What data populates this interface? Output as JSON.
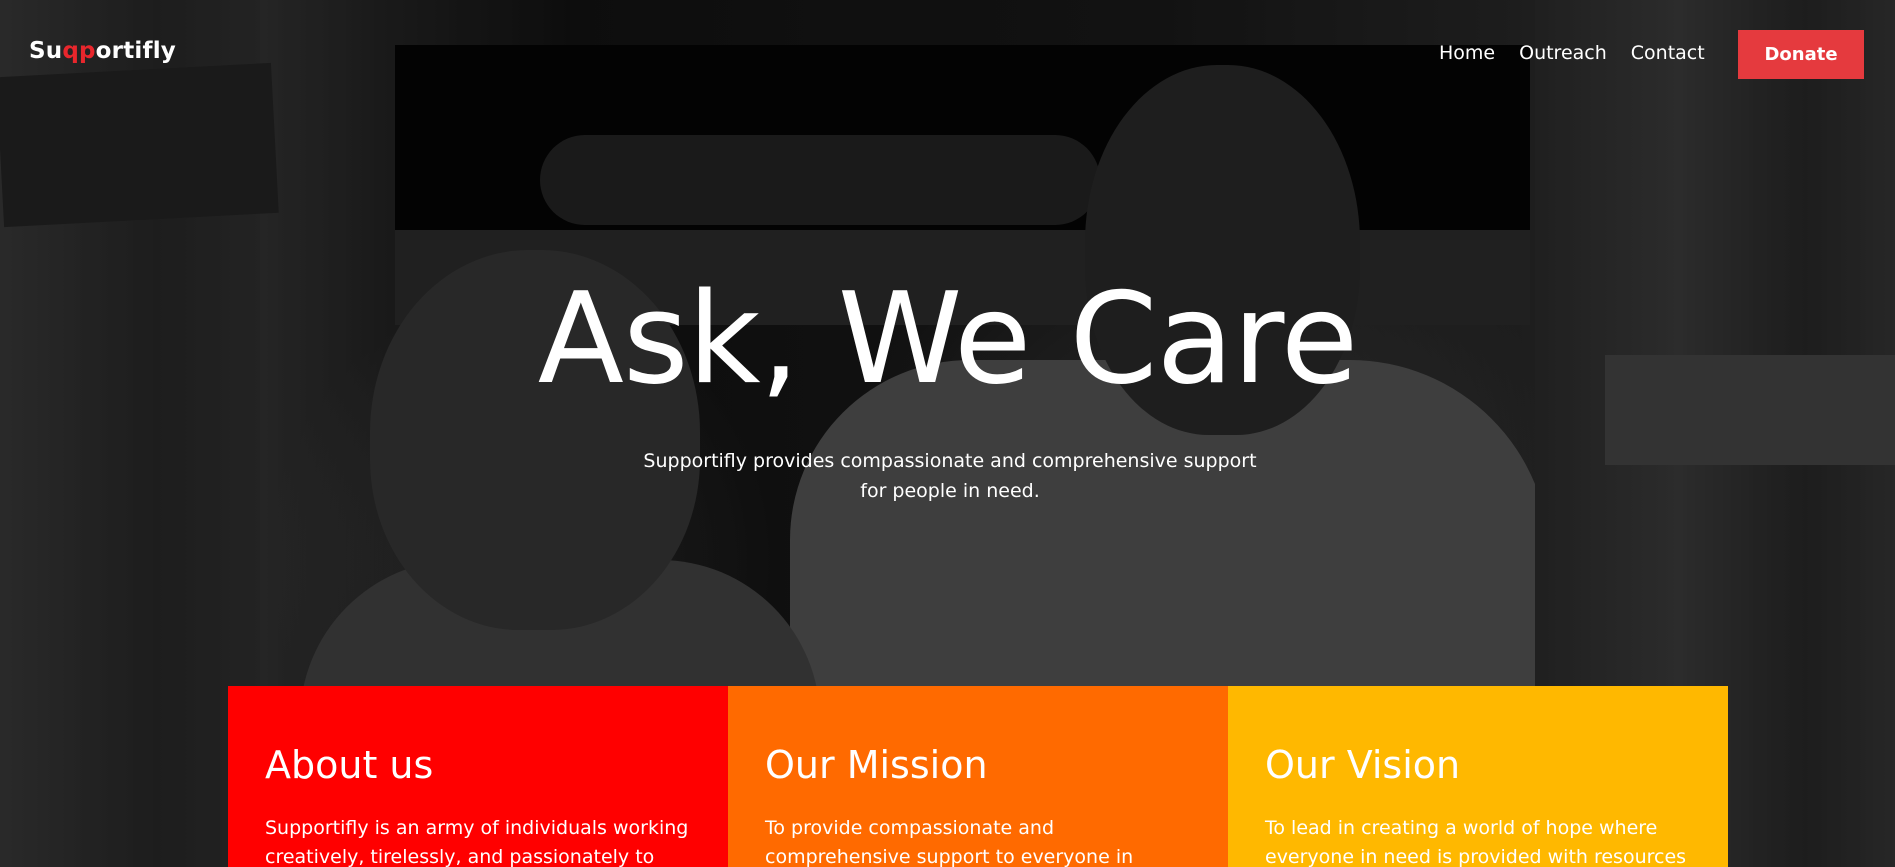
{
  "brand": {
    "logo_prefix": "Su",
    "logo_accent": "qp",
    "logo_suffix": "ortifly",
    "accent_color": "#e8262c"
  },
  "nav": {
    "items": [
      {
        "label": "Home"
      },
      {
        "label": "Outreach"
      },
      {
        "label": "Contact"
      }
    ],
    "donate_label": "Donate",
    "donate_color": "#e53a3e"
  },
  "hero": {
    "title": "Ask, We Care",
    "subtitle": "Supportifly provides compassionate and comprehensive support for people in need."
  },
  "cards": [
    {
      "title": "About us",
      "text": "Supportifly is an army of individuals working creatively, tirelessly, and passionately to create",
      "color": "#ff0000"
    },
    {
      "title": "Our Mission",
      "text": "To provide compassionate and comprehensive support to everyone in need, empowering them",
      "color": "#ff6a00"
    },
    {
      "title": "Our Vision",
      "text": "To lead in creating a world of hope where everyone in need is provided with resources",
      "color": "#ffb800"
    }
  ]
}
